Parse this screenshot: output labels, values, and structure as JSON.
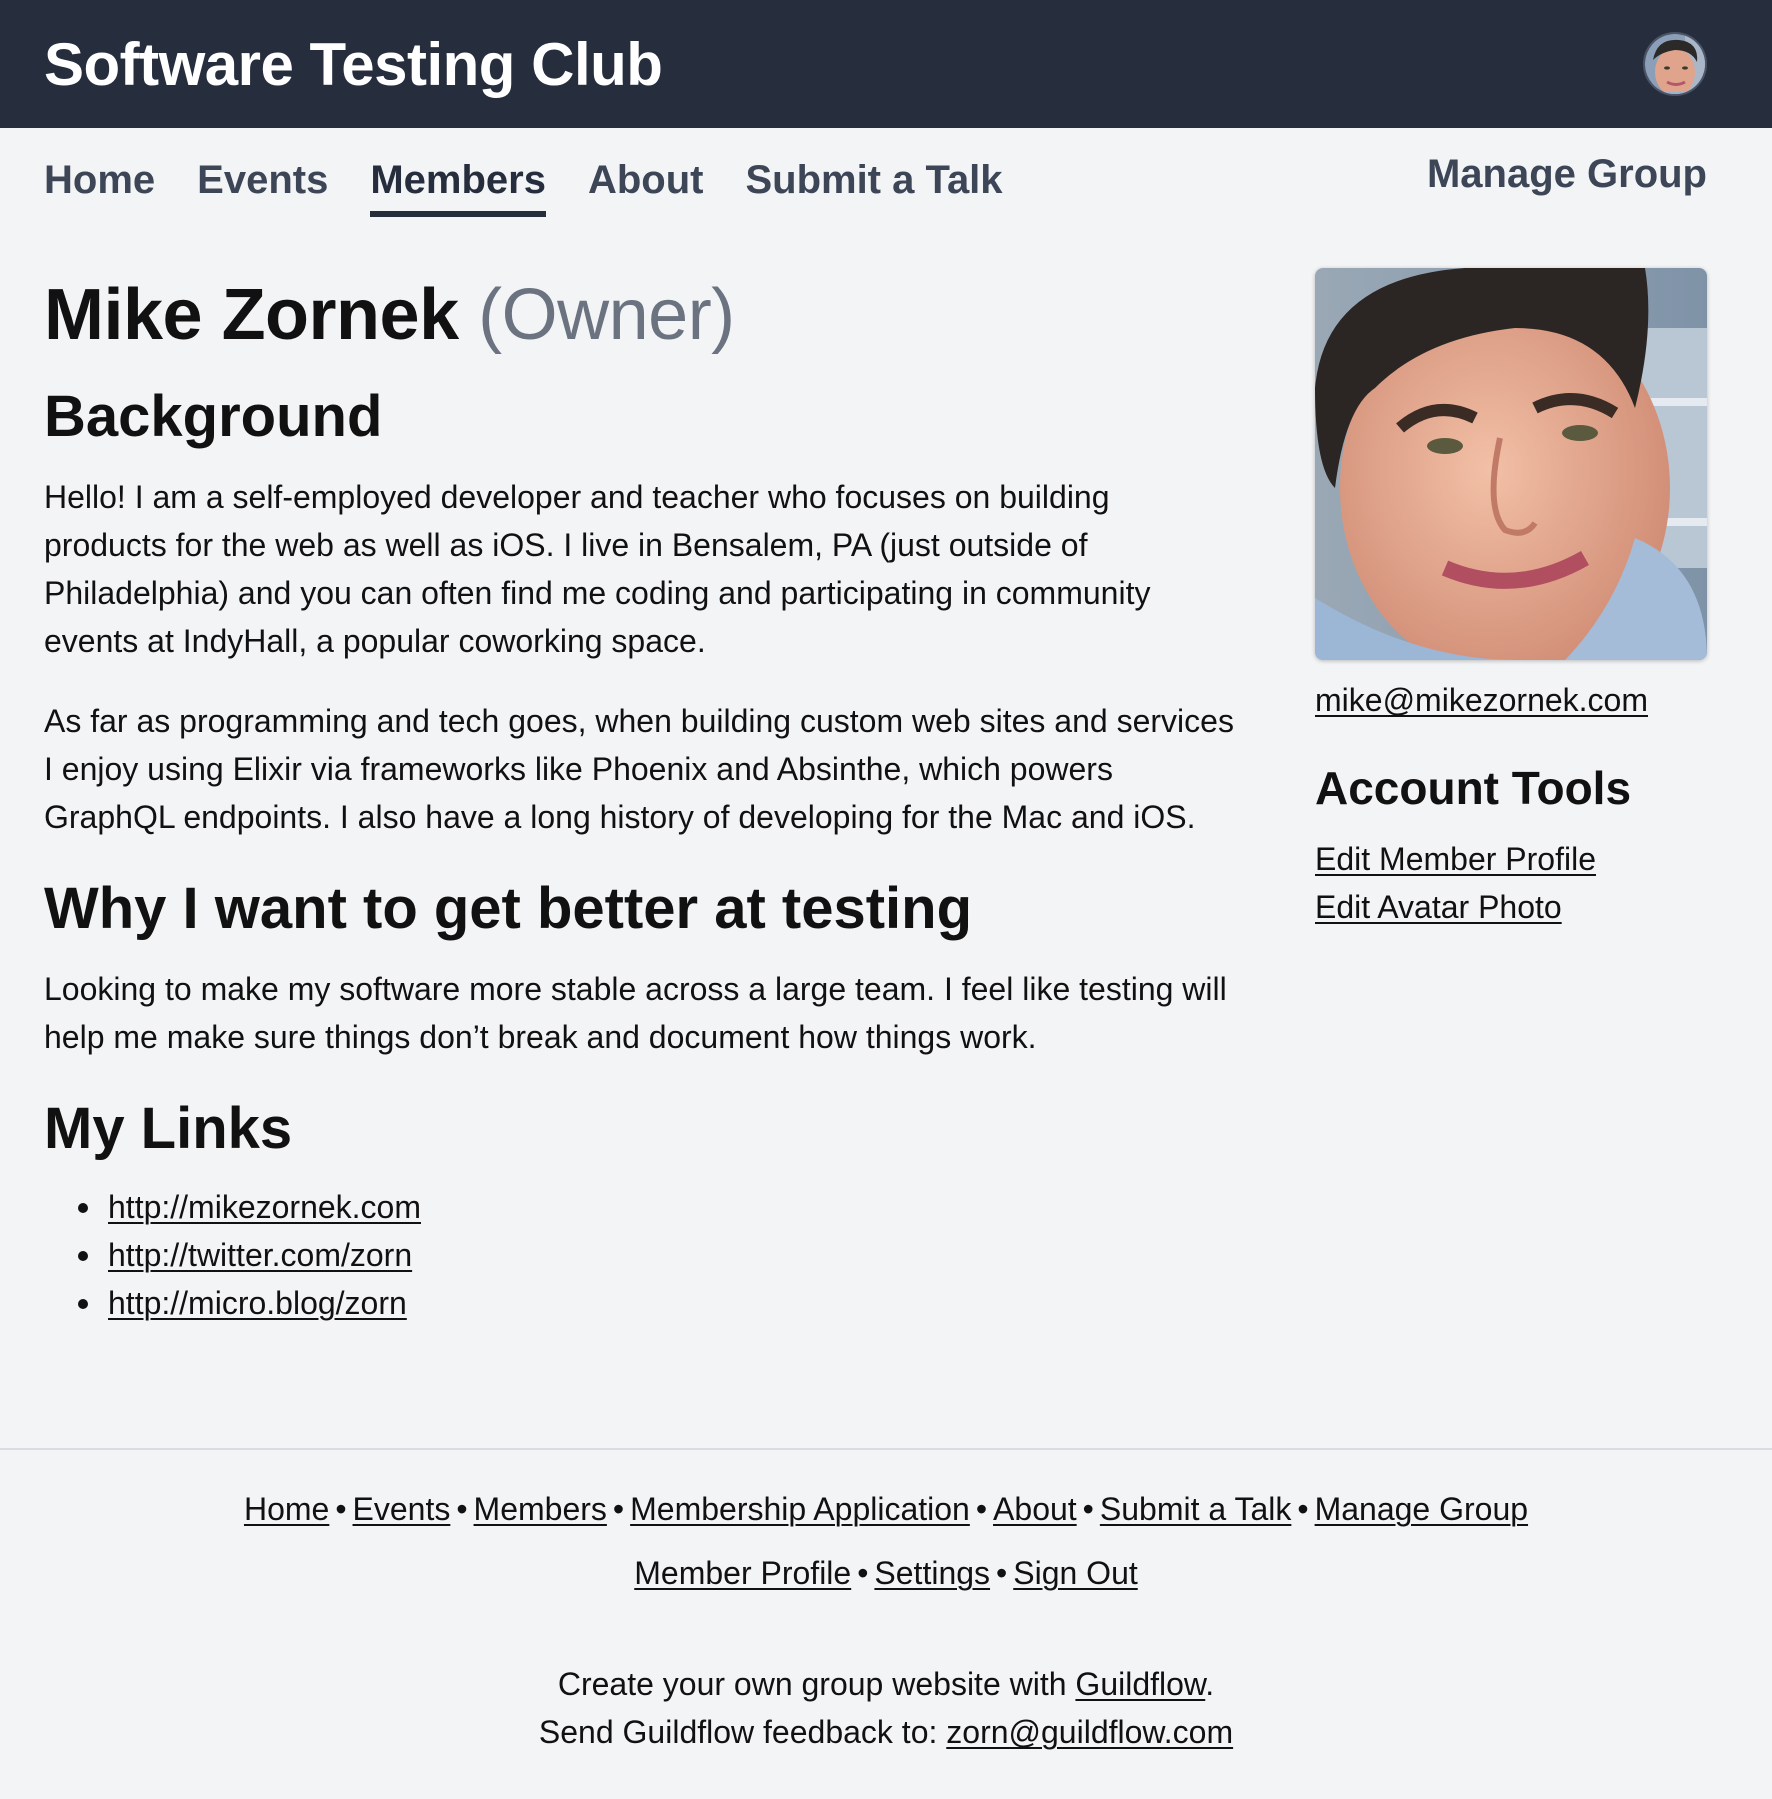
{
  "header": {
    "brand": "Software Testing Club"
  },
  "nav": {
    "items": [
      {
        "label": "Home",
        "active": false
      },
      {
        "label": "Events",
        "active": false
      },
      {
        "label": "Members",
        "active": true
      },
      {
        "label": "About",
        "active": false
      },
      {
        "label": "Submit a Talk",
        "active": false
      }
    ],
    "manage": "Manage Group"
  },
  "profile": {
    "name": "Mike Zornek",
    "role": "(Owner)",
    "background_heading": "Background",
    "background_paragraphs": [
      "Hello! I am a self-employed developer and teacher who focuses on building products for the web as well as iOS. I live in Bensalem, PA (just outside of Philadelphia) and you can often find me coding and participating in community events at IndyHall, a popular coworking space.",
      "As far as programming and tech goes, when building custom web sites and services I enjoy using Elixir via frameworks like Phoenix and Absinthe, which powers GraphQL endpoints. I also have a long history of developing for the Mac and iOS."
    ],
    "why_heading": "Why I want to get better at testing",
    "why_text": "Looking to make my software more stable across a large team. I feel like testing will help me make sure things don’t break and document how things work.",
    "links_heading": "My Links",
    "links": [
      "http://mikezornek.com",
      "http://twitter.com/zorn",
      "http://micro.blog/zorn"
    ]
  },
  "sidebar": {
    "email": "mike@mikezornek.com",
    "tools_heading": "Account Tools",
    "tools": [
      "Edit Member Profile",
      "Edit Avatar Photo"
    ]
  },
  "footer": {
    "row1": [
      "Home",
      "Events",
      "Members",
      "Membership Application",
      "About",
      "Submit a Talk",
      "Manage Group"
    ],
    "row2": [
      "Member Profile",
      "Settings",
      "Sign Out"
    ],
    "separator": "•",
    "create_prefix": "Create your own group website with ",
    "create_link": "Guildflow",
    "create_suffix": ".",
    "feedback_prefix": "Send Guildflow feedback to: ",
    "feedback_link": "zorn@guildflow.com"
  },
  "colors": {
    "header_bg": "#262e3e",
    "page_bg": "#f3f4f6",
    "role_gray": "#6b7280"
  }
}
